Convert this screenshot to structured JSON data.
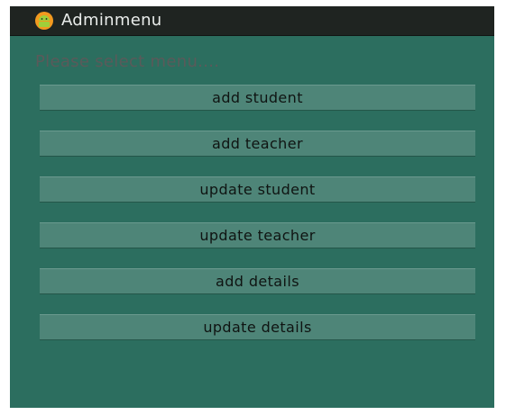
{
  "app": {
    "title": "Adminmenu",
    "icon": "android-app-icon"
  },
  "prompt_text": "Please select menu....",
  "menu": [
    {
      "label": "add student"
    },
    {
      "label": "add teacher"
    },
    {
      "label": "update student"
    },
    {
      "label": "update teacher"
    },
    {
      "label": "add details"
    },
    {
      "label": "update details"
    }
  ],
  "colors": {
    "actionbar": "#1f2421",
    "background": "#2c6e5f",
    "button": "#4e8578",
    "icon_green": "#9fcf3a",
    "icon_orange": "#f29a1f"
  }
}
